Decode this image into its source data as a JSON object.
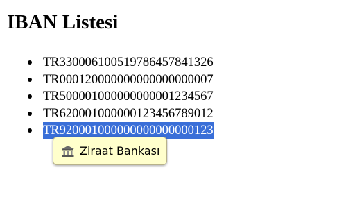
{
  "page": {
    "title": "IBAN Listesi"
  },
  "iban_list": {
    "items": [
      {
        "value": "TR330006100519786457841326",
        "selected": false
      },
      {
        "value": "TR000120000000000000000007",
        "selected": false
      },
      {
        "value": "TR500001000000000001234567",
        "selected": false
      },
      {
        "value": "TR620001000000123456789012",
        "selected": false
      },
      {
        "value": "TR920001000000000000000123",
        "selected": true
      }
    ]
  },
  "tooltip": {
    "icon": "bank-icon",
    "label": "Ziraat Bankası"
  },
  "colors": {
    "selection_background": "#3a6fd8",
    "tooltip_background": "#ffffcc"
  }
}
